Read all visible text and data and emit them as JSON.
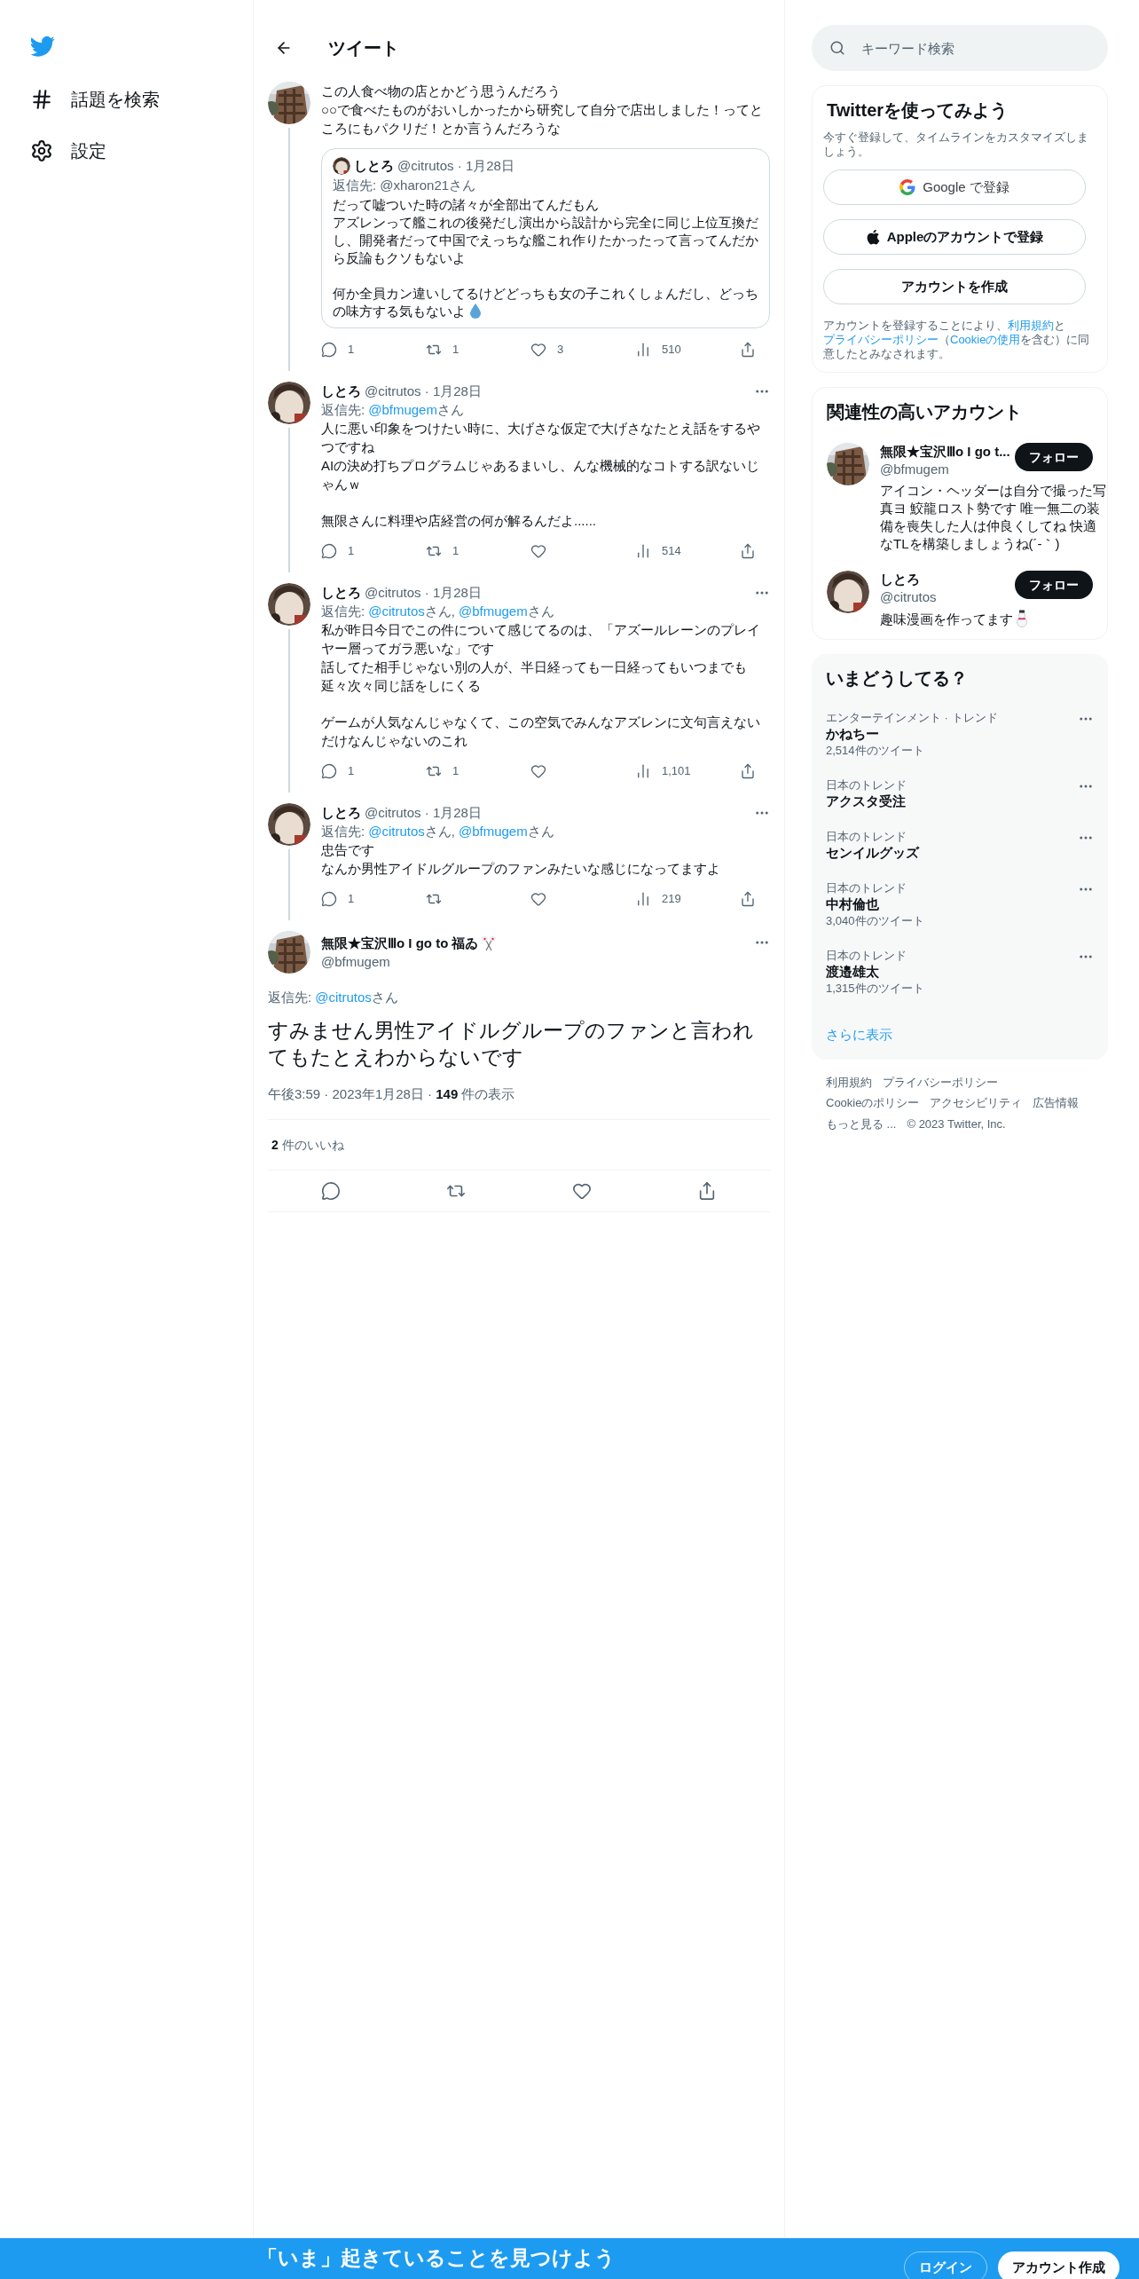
{
  "sidebar": {
    "items": [
      {
        "kind": "hash",
        "label": "話題を検索"
      },
      {
        "kind": "gear",
        "label": "設定"
      }
    ]
  },
  "header": {
    "title": "ツイート"
  },
  "thread": [
    {
      "body": [
        [
          "この人食べ物の店とかどう思うんだろう",
          "○○で食べたものがおいしかったから研究して自分で店出しました！ってところにもパクリだ！とか言うんだろうな"
        ]
      ],
      "quote": {
        "name": "しとろ",
        "meta": "@citrutos · 1月28日",
        "reply": "返信先: @xharon21さん",
        "body": [
          [
            "だって嘘ついた時の諸々が全部出てんだもん",
            "アズレンって艦これの後発だし演出から設計から完全に同じ上位互換だし、開発者だって中国でえっちな艦これ作りたかったって言ってんだから反論もクソもないよ"
          ],
          [
            "何か全員カン違いしてるけどどっちも女の子これくしょんだし、どっちの味方する気もないよ"
          ]
        ]
      },
      "stats": {
        "replies": "1",
        "retweets": "1",
        "likes": "3",
        "views": "510"
      }
    },
    {
      "name": "しとろ",
      "meta": "@citrutos · 1月28日",
      "reply_prefix": "返信先:",
      "mentions": [
        {
          "handle": "@bfmugem",
          "suffix": "さん"
        }
      ],
      "body": [
        [
          "人に悪い印象をつけたい時に、大げさな仮定で大げさなたとえ話をするやつですね",
          "AIの決め打ちプログラムじゃあるまいし、んな機械的なコトする訳ないじゃんｗ"
        ],
        [
          "無限さんに料理や店経営の何が解るんだよ......"
        ]
      ],
      "stats": {
        "replies": "1",
        "retweets": "1",
        "views": "514"
      }
    },
    {
      "name": "しとろ",
      "meta": "@citrutos · 1月28日",
      "reply_prefix": "返信先:",
      "mentions": [
        {
          "handle": "@citrutos",
          "suffix": "さん,"
        },
        {
          "handle": "@bfmugem",
          "suffix": "さん"
        }
      ],
      "body": [
        [
          "私が昨日今日でこの件について感じてるのは、「アズールレーンのプレイヤー層ってガラ悪いな」です",
          "話してた相手じゃない別の人が、半日経っても一日経ってもいつまでも延々次々同じ話をしにくる"
        ],
        [
          "ゲームが人気なんじゃなくて、この空気でみんなアズレンに文句言えないだけなんじゃないのこれ"
        ]
      ],
      "stats": {
        "replies": "1",
        "retweets": "1",
        "views": "1,101"
      }
    },
    {
      "name": "しとろ",
      "meta": "@citrutos · 1月28日",
      "reply_prefix": "返信先:",
      "mentions": [
        {
          "handle": "@citrutos",
          "suffix": "さん,"
        },
        {
          "handle": "@bfmugem",
          "suffix": "さん"
        }
      ],
      "body": [
        [
          "忠告です",
          "なんか男性アイドルグループのファンみたいな感じになってますよ"
        ]
      ],
      "stats": {
        "replies": "1",
        "views": "219"
      }
    }
  ],
  "main_tweet": {
    "name": "無限★宝沢Ⅲo I go to 福ゐ",
    "handle": "@bfmugem",
    "reply_prefix": "返信先:",
    "mentions": [
      {
        "handle": "@citrutos",
        "suffix": "さん"
      }
    ],
    "body": "すみません男性アイドルグループのファンと言われてもたとえわからないです",
    "meta": "午後3:59 · 2023年1月28日 · **149** 件の表示",
    "likes": "**2** 件のいいね"
  },
  "search": {
    "placeholder": "キーワード検索"
  },
  "signup_card": {
    "title": "Twitterを使ってみよう",
    "subtitle": "今すぐ登録して、タイムラインをカスタマイズしましょう。",
    "buttons": [
      {
        "kind": "google",
        "label": "Google で登録"
      },
      {
        "kind": "apple",
        "label": "Appleのアカウントで登録"
      },
      {
        "kind": "plain",
        "label": "アカウントを作成"
      }
    ],
    "legal": [
      {
        "text": "アカウントを登録することにより、",
        "link": false
      },
      {
        "text": "利用規約",
        "link": true
      },
      {
        "text": "と",
        "link": false
      },
      {
        "text": "プライバシーポリシー",
        "link": true
      },
      {
        "text": "（",
        "link": false
      },
      {
        "text": "Cookieの使用",
        "link": true
      },
      {
        "text": "を含む）に同意したとみなされます。",
        "link": false
      }
    ]
  },
  "accounts_card": {
    "title": "関連性の高いアカウント",
    "accounts": [
      {
        "name": "無限★宝沢Ⅲo I go t...",
        "handle": "@bfmugem",
        "bio": [
          "アイコン・ヘッダーは自分で撮った写真ヨ 鮫龍ロスト勢です 唯一無二の装備を喪失した人は仲良くしてね 快適なTLを構築しましょうね(´-｀)"
        ],
        "button": "フォロー"
      },
      {
        "name": "しとろ",
        "handle": "@citrutos",
        "bio": [
          "趣味漫画を作ってます"
        ],
        "button": "フォロー"
      }
    ]
  },
  "trends_card": {
    "title": "いまどうしてる？",
    "trends": [
      {
        "context": "エンターテインメント · トレンド",
        "title": "かねちー",
        "count": "2,514件のツイート"
      },
      {
        "context": "日本のトレンド",
        "title": "アクスタ受注"
      },
      {
        "context": "日本のトレンド",
        "title": "センイルグッズ"
      },
      {
        "context": "日本のトレンド",
        "title": "中村倫也",
        "count": "3,040件のツイート"
      },
      {
        "context": "日本のトレンド",
        "title": "渡邉雄太",
        "count": "1,315件のツイート"
      }
    ],
    "more": "さらに表示"
  },
  "footer": {
    "links": [
      "利用規約",
      "プライバシーポリシー",
      "Cookieのポリシー",
      "アクセシビリティ",
      "広告情報",
      "もっと見る ..."
    ],
    "copyright": "© 2023 Twitter, Inc."
  },
  "banner": {
    "title": "「いま」起きていることを見つけよう",
    "login": "ログイン",
    "signup": "アカウント作成"
  }
}
